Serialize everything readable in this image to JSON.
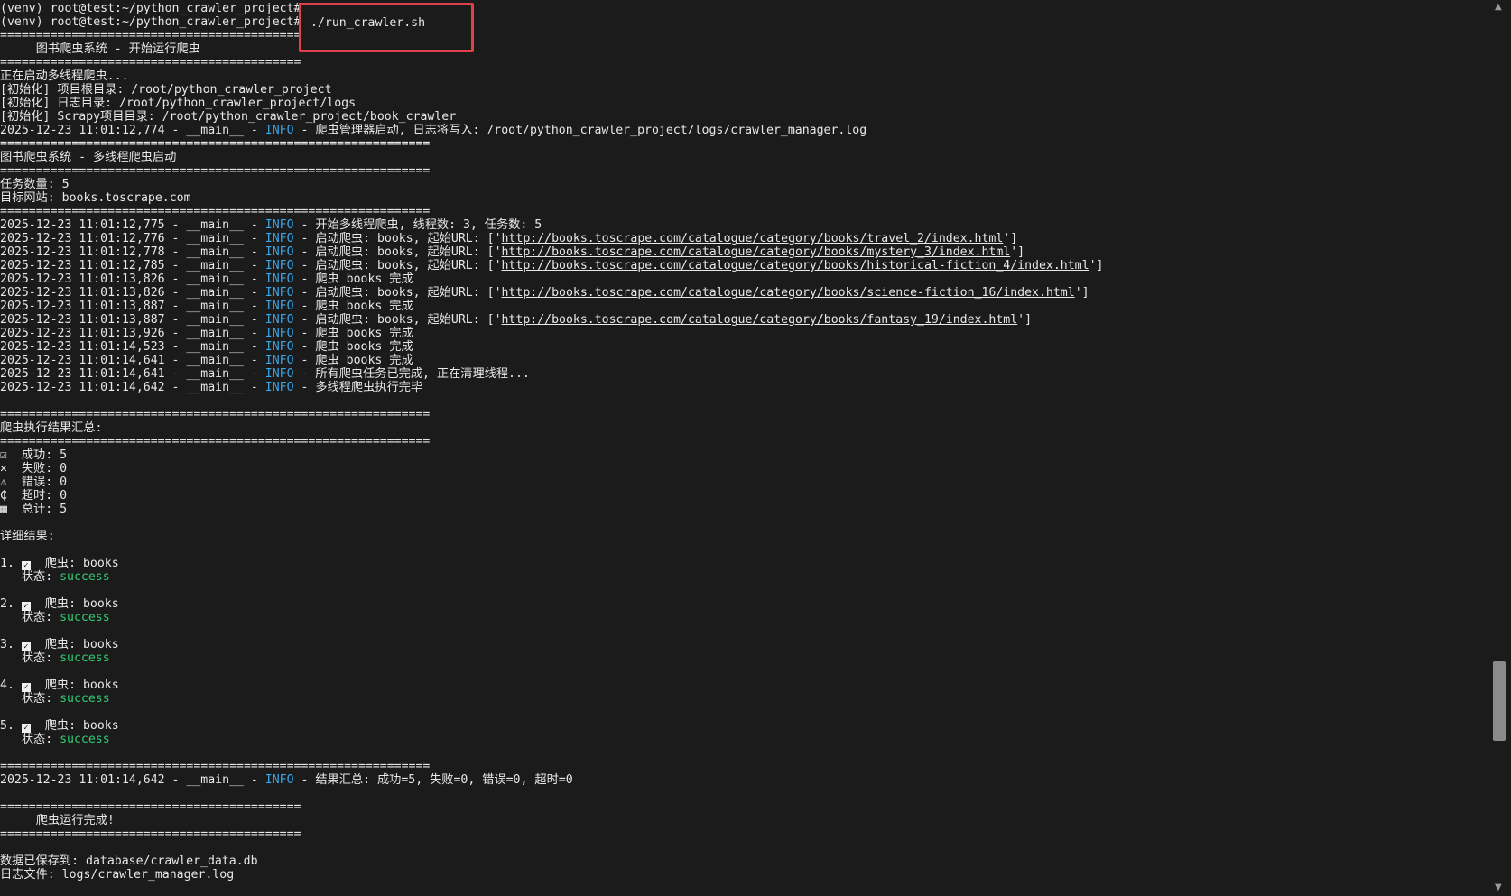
{
  "terminal": {
    "prompt1": "(venv) root@test:~/python_crawler_project#",
    "prompt2": "(venv) root@test:~/python_crawler_project#",
    "command": "./run_crawler.sh",
    "sep_short": "==========================================",
    "sep_long": "============================================================",
    "banner_title": "     图书爬虫系统 - 开始运行爬虫",
    "starting": "正在启动多线程爬虫...",
    "init_lines": [
      "[初始化] 项目根目录: /root/python_crawler_project",
      "[初始化] 日志目录: /root/python_crawler_project/logs",
      "[初始化] Scrapy项目目录: /root/python_crawler_project/book_crawler"
    ],
    "manager_log": {
      "ts": "2025-12-23 11:01:12,774 - __main__ - ",
      "level": "INFO",
      "msg": " - 爬虫管理器启动, 日志将写入: /root/python_crawler_project/logs/crawler_manager.log"
    },
    "system_title": "图书爬虫系统 - 多线程爬虫启动",
    "task_count": "任务数量: 5",
    "target_site": "目标网站: books.toscrape.com",
    "log_lines": [
      {
        "ts": "2025-12-23 11:01:12,775 - __main__ - ",
        "level": "INFO",
        "msg": " - 开始多线程爬虫, 线程数: 3, 任务数: 5",
        "url": "",
        "tail": ""
      },
      {
        "ts": "2025-12-23 11:01:12,776 - __main__ - ",
        "level": "INFO",
        "msg": " - 启动爬虫: books, 起始URL: ['",
        "url": "http://books.toscrape.com/catalogue/category/books/travel_2/index.html",
        "tail": "']"
      },
      {
        "ts": "2025-12-23 11:01:12,778 - __main__ - ",
        "level": "INFO",
        "msg": " - 启动爬虫: books, 起始URL: ['",
        "url": "http://books.toscrape.com/catalogue/category/books/mystery_3/index.html",
        "tail": "']"
      },
      {
        "ts": "2025-12-23 11:01:12,785 - __main__ - ",
        "level": "INFO",
        "msg": " - 启动爬虫: books, 起始URL: ['",
        "url": "http://books.toscrape.com/catalogue/category/books/historical-fiction_4/index.html",
        "tail": "']"
      },
      {
        "ts": "2025-12-23 11:01:13,826 - __main__ - ",
        "level": "INFO",
        "msg": " - 爬虫 books 完成",
        "url": "",
        "tail": ""
      },
      {
        "ts": "2025-12-23 11:01:13,826 - __main__ - ",
        "level": "INFO",
        "msg": " - 启动爬虫: books, 起始URL: ['",
        "url": "http://books.toscrape.com/catalogue/category/books/science-fiction_16/index.html",
        "tail": "']"
      },
      {
        "ts": "2025-12-23 11:01:13,887 - __main__ - ",
        "level": "INFO",
        "msg": " - 爬虫 books 完成",
        "url": "",
        "tail": ""
      },
      {
        "ts": "2025-12-23 11:01:13,887 - __main__ - ",
        "level": "INFO",
        "msg": " - 启动爬虫: books, 起始URL: ['",
        "url": "http://books.toscrape.com/catalogue/category/books/fantasy_19/index.html",
        "tail": "']"
      },
      {
        "ts": "2025-12-23 11:01:13,926 - __main__ - ",
        "level": "INFO",
        "msg": " - 爬虫 books 完成",
        "url": "",
        "tail": ""
      },
      {
        "ts": "2025-12-23 11:01:14,523 - __main__ - ",
        "level": "INFO",
        "msg": " - 爬虫 books 完成",
        "url": "",
        "tail": ""
      },
      {
        "ts": "2025-12-23 11:01:14,641 - __main__ - ",
        "level": "INFO",
        "msg": " - 爬虫 books 完成",
        "url": "",
        "tail": ""
      },
      {
        "ts": "2025-12-23 11:01:14,641 - __main__ - ",
        "level": "INFO",
        "msg": " - 所有爬虫任务已完成, 正在清理线程...",
        "url": "",
        "tail": ""
      },
      {
        "ts": "2025-12-23 11:01:14,642 - __main__ - ",
        "level": "INFO",
        "msg": " - 多线程爬虫执行完毕",
        "url": "",
        "tail": ""
      }
    ],
    "summary_title": "爬虫执行结果汇总:",
    "summary": [
      {
        "icon": "☑",
        "text": "  成功: 5"
      },
      {
        "icon": "✕",
        "text": "  失败: 0"
      },
      {
        "icon": "⚠",
        "text": "  错误: 0"
      },
      {
        "icon": "₵",
        "text": "  超时: 0"
      },
      {
        "icon": "▦",
        "text": "  总计: 5"
      }
    ],
    "details_title": "详细结果:",
    "details": [
      {
        "num": "1. ",
        "spider": "  爬虫: books",
        "status_label": "   状态: ",
        "status": "success"
      },
      {
        "num": "2. ",
        "spider": "  爬虫: books",
        "status_label": "   状态: ",
        "status": "success"
      },
      {
        "num": "3. ",
        "spider": "  爬虫: books",
        "status_label": "   状态: ",
        "status": "success"
      },
      {
        "num": "4. ",
        "spider": "  爬虫: books",
        "status_label": "   状态: ",
        "status": "success"
      },
      {
        "num": "5. ",
        "spider": "  爬虫: books",
        "status_label": "   状态: ",
        "status": "success"
      }
    ],
    "final_log": {
      "ts": "2025-12-23 11:01:14,642 - __main__ - ",
      "level": "INFO",
      "msg": " - 结果汇总: 成功=5, 失败=0, 错误=0, 超时=0"
    },
    "done_title": "     爬虫运行完成!",
    "saved_db": "数据已保存到: database/crawler_data.db",
    "log_file": "日志文件: logs/crawler_manager.log"
  },
  "colors": {
    "background": "#1b1b1b",
    "text": "#e8e8e8",
    "info": "#3aa5e6",
    "success": "#2ecc71",
    "highlight": "#e0404a"
  },
  "scrollbar": {
    "up_icon": "▲",
    "down_icon": "▼"
  }
}
